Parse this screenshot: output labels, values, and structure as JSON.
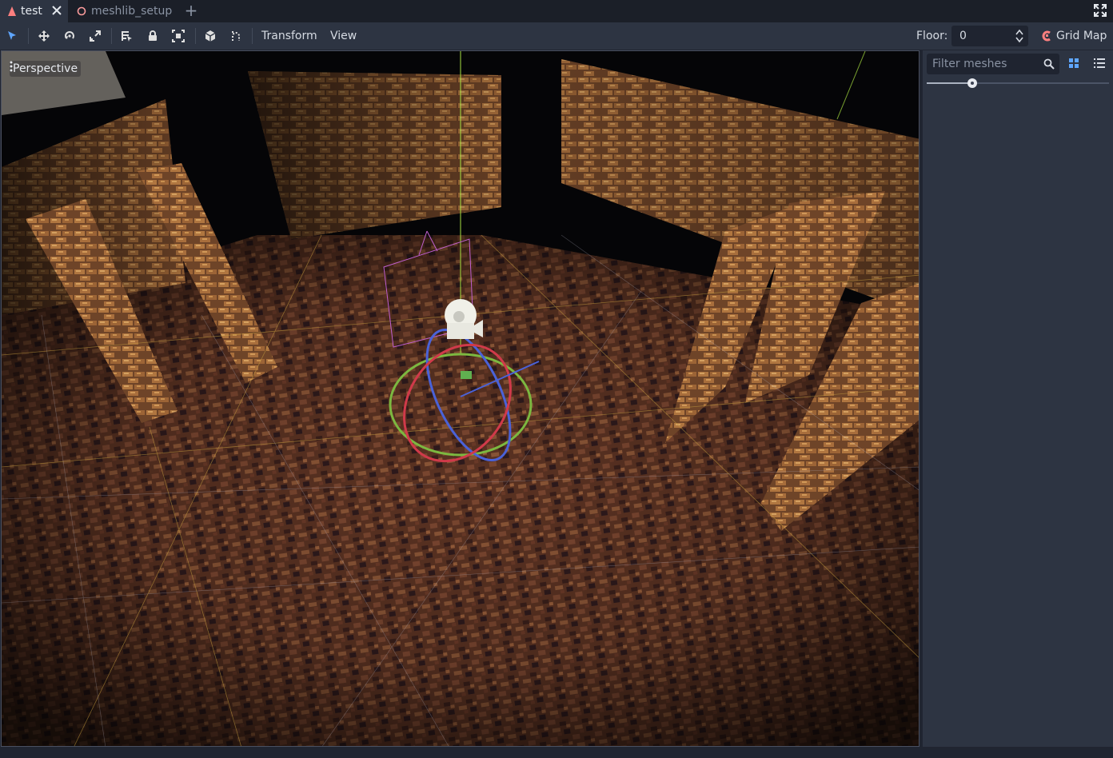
{
  "tabs": [
    {
      "label": "test",
      "icon": "scene-3d-icon",
      "active": true
    },
    {
      "label": "meshlib_setup",
      "icon": "scene-circle-icon",
      "active": false
    }
  ],
  "toolbar": {
    "tools": [
      "select-tool-icon",
      "move-tool-icon",
      "rotate-tool-icon",
      "scale-tool-icon",
      "list-select-icon",
      "lock-icon",
      "group-icon",
      "local-space-icon",
      "snap-icon"
    ],
    "menus": {
      "transform": "Transform",
      "view": "View"
    },
    "floor_label": "Floor:",
    "floor_value": "0",
    "gridmap_label": "Grid Map"
  },
  "viewport": {
    "perspective_label": "Perspective"
  },
  "panel": {
    "filter_placeholder": "Filter meshes",
    "zoom_level": 0.25
  },
  "colors": {
    "accent": "#5fa6ff",
    "gridmap_icon": "#fc7f7f",
    "tab_icon_test": "#fc7f7f",
    "tab_icon_meshlib": "#fc9c9c"
  }
}
